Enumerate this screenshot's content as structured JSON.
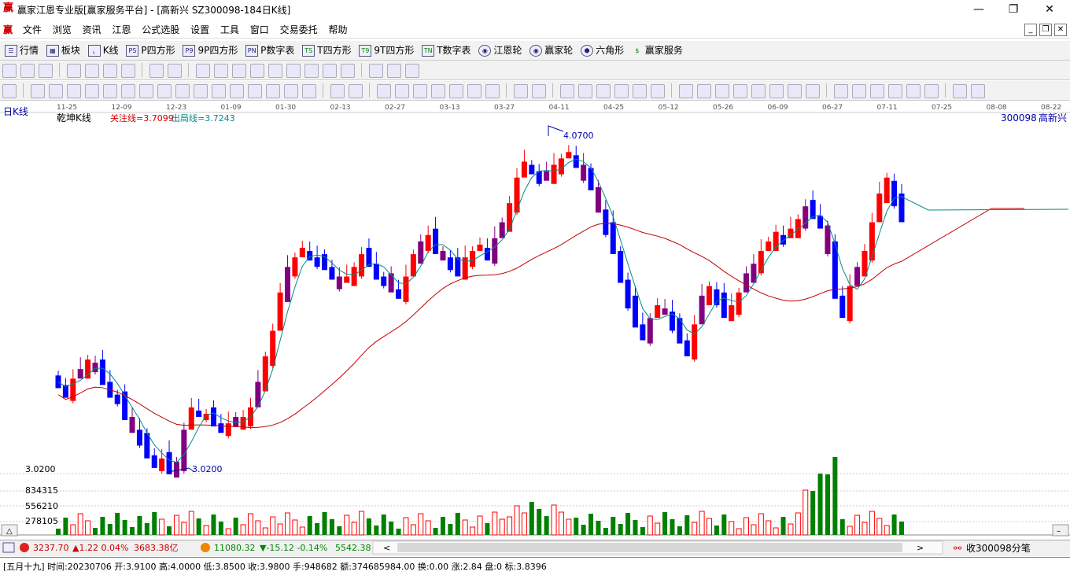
{
  "window": {
    "title": "赢家江恩专业版[赢家服务平台] - [高新兴  SZ300098-184日K线]",
    "logo": "赢"
  },
  "menu": {
    "logo": "赢",
    "items": [
      "文件",
      "浏览",
      "资讯",
      "江恩",
      "公式选股",
      "设置",
      "工具",
      "窗口",
      "交易委托",
      "帮助"
    ]
  },
  "toolbar1": {
    "items": [
      {
        "icon": "list-icon",
        "label": "行情"
      },
      {
        "icon": "blocks-icon",
        "label": "板块"
      },
      {
        "icon": "kline-icon",
        "label": "K线"
      },
      {
        "icon": "ps-icon",
        "label": "P四方形"
      },
      {
        "icon": "p9-icon",
        "label": "9P四方形"
      },
      {
        "icon": "pn-icon",
        "label": "P数字表"
      },
      {
        "icon": "ts-icon",
        "label": "T四方形"
      },
      {
        "icon": "t9-icon",
        "label": "9T四方形"
      },
      {
        "icon": "tn-icon",
        "label": "T数字表"
      },
      {
        "icon": "wheel-icon",
        "label": "江恩轮"
      },
      {
        "icon": "wheel2-icon",
        "label": "赢家轮"
      },
      {
        "icon": "hexagon-icon",
        "label": "六角形"
      },
      {
        "icon": "dollar-icon",
        "label": "赢家服务"
      }
    ]
  },
  "chart": {
    "period_label": "日K线",
    "indicator_name": "乾坤K线",
    "focus_line": "关注线=3.7099",
    "exit_line": "出局线=3.7243",
    "stock_code": "300098",
    "stock_name": "高新兴",
    "high_label": "4.0700",
    "low_label": "3.0200",
    "low_annot": "3.0200",
    "date_ticks": [
      "11-25",
      "12-09",
      "12-23",
      "01-09",
      "01-30",
      "02-13",
      "02-27",
      "03-13",
      "03-27",
      "04-11",
      "04-25",
      "05-12",
      "05-26",
      "06-09",
      "06-27",
      "07-11",
      "07-25",
      "08-08",
      "08-22"
    ],
    "volume_ticks": [
      "834315",
      "556210",
      "278105"
    ],
    "colors": {
      "up": "#ff0000",
      "down": "#0000ff",
      "neutral": "#800080",
      "ma_short": "#008b8b",
      "ma_long": "#c00000",
      "vol_up": "#ff0000",
      "vol_down": "#008000"
    }
  },
  "chart_data": {
    "type": "candlestick",
    "title": "",
    "y_range": [
      3.02,
      4.07
    ],
    "series": [
      {
        "name": "关注线",
        "value": 3.7099
      },
      {
        "name": "出局线",
        "value": 3.7243
      }
    ]
  },
  "statusbar": {
    "sh_index": "3237.70",
    "sh_change": "▲1.22 0.04%",
    "sh_amount": "3683.38亿",
    "sz_index": "11080.32",
    "sz_change": "▼-15.12 -0.14%",
    "sz_amount": "5542.38",
    "right_text": "收300098分笔"
  },
  "footer": {
    "text": "[五月十九] 时间:20230706 开:3.9100 高:4.0000 低:3.8500 收:3.9800 手:948682 额:374685984.00 换:0.00 涨:2.84 盘:0 标:3.8396"
  }
}
